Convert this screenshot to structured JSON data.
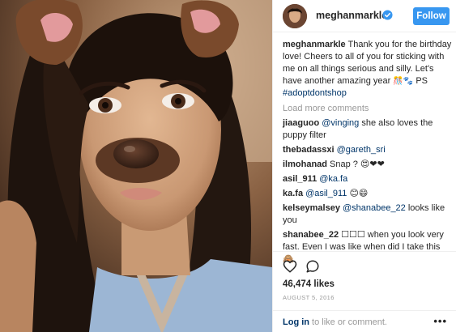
{
  "post": {
    "username": "meghanmarkle",
    "follow_label": "Follow",
    "caption_user": "meghanmarkle",
    "caption_text": " Thank you for the birthday love! Cheers to all of you for sticking with me on all things serious and silly. Let's have another amazing year ",
    "caption_emoji": "🎊🐾",
    "caption_ps": " PS ",
    "caption_tag": "#adoptdontshop",
    "load_more": "Load more comments",
    "likes": "46,474 likes",
    "date": "AUGUST 5, 2016",
    "login_link": "Log in",
    "login_rest": " to like or comment.",
    "more": "•••"
  },
  "comments": [
    {
      "user": "jiaaguoo",
      "mention": "@vinging",
      "text": " she also loves the puppy filter"
    },
    {
      "user": "thebadassxi",
      "mention": "@gareth_sri",
      "text": ""
    },
    {
      "user": "ilmohanad",
      "mention": "",
      "text": "Snap ? 😍❤❤"
    },
    {
      "user": "asil_911",
      "mention": "@ka.fa",
      "text": ""
    },
    {
      "user": "ka.fa",
      "mention": "@asil_911",
      "text": " 😊😄"
    },
    {
      "user": "kelseymalsey",
      "mention": "@shanabee_22",
      "text": " looks like you"
    },
    {
      "user": "shanabee_22",
      "mention": "",
      "text": "☐☐☐ when you look very fast. Even I was like when did I take this 🙈"
    }
  ],
  "colors": {
    "accent": "#3897f0",
    "link": "#003569",
    "muted": "#999999"
  },
  "icons": {
    "verified": "verified-badge-icon",
    "like": "heart-icon",
    "comment": "comment-icon",
    "more": "more-options-icon"
  }
}
